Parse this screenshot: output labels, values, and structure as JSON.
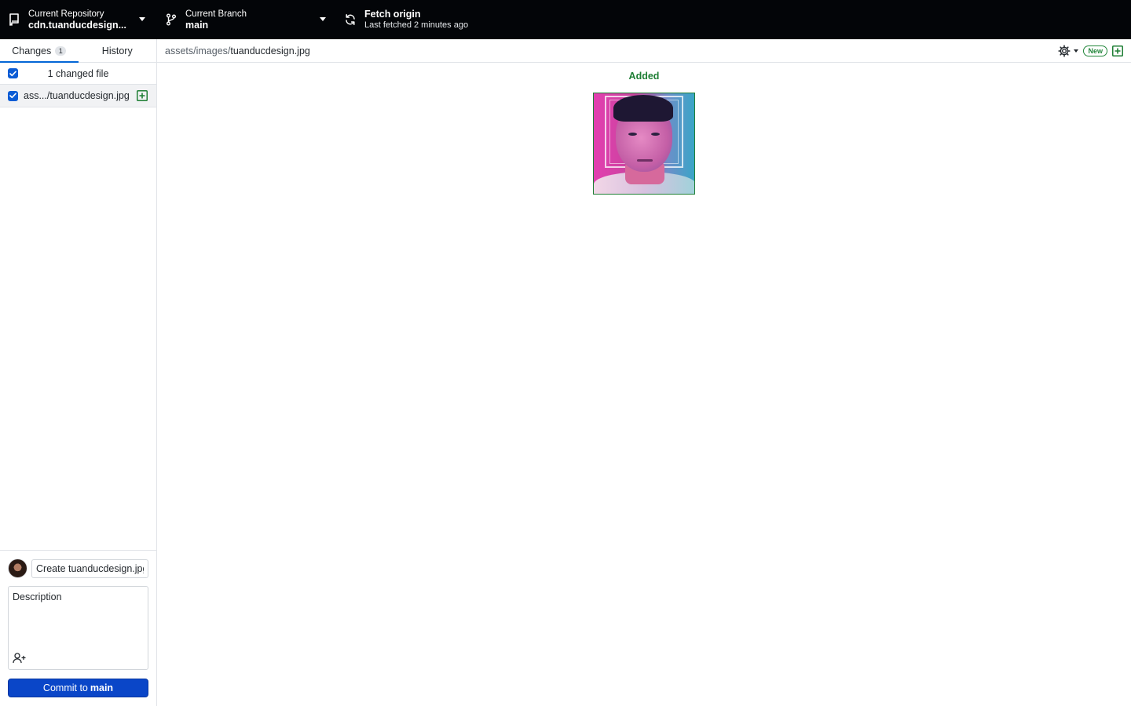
{
  "toolbar": {
    "repository": {
      "label": "Current Repository",
      "value": "cdn.tuanducdesign..."
    },
    "branch": {
      "label": "Current Branch",
      "value": "main"
    },
    "fetch": {
      "label": "Fetch origin",
      "subtitle": "Last fetched 2 minutes ago"
    }
  },
  "sidebar": {
    "tabs": [
      {
        "label": "Changes",
        "count": "1",
        "active": true
      },
      {
        "label": "History",
        "active": false
      }
    ],
    "changes_header": "1 changed file",
    "files": [
      {
        "name": "ass.../tuanducdesign.jpg",
        "status": "added",
        "checked": true
      }
    ]
  },
  "commit": {
    "summary_value": "Create tuanducdesign.jpg",
    "description_placeholder": "Description",
    "button_prefix": "Commit to",
    "button_branch": "main"
  },
  "diff": {
    "path_dir": "assets/images/",
    "path_file": "tuanducdesign.jpg",
    "new_badge": "New",
    "status_label": "Added"
  },
  "colors": {
    "toolbar_bg": "#030508",
    "accent_blue": "#0a46c8",
    "added_green": "#1e7e34"
  },
  "icons": [
    "repo-icon",
    "branch-icon",
    "sync-icon",
    "gear-icon",
    "file-added-icon",
    "add-coauthor-icon",
    "check-icon"
  ]
}
